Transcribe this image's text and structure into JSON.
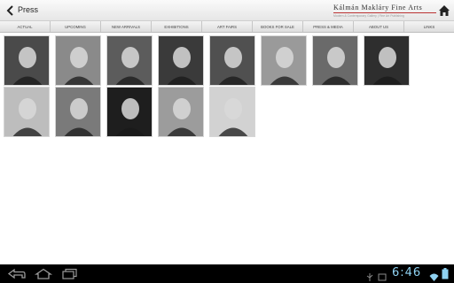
{
  "app": {
    "title": "Press",
    "back_icon": "back-chevron-icon",
    "home_icon": "home-icon",
    "brand": {
      "name": "Kálmán Makláry Fine Arts",
      "tagline": "Modern & Contemporary Gallery | Fine Art Publishing"
    }
  },
  "nav": {
    "items": [
      {
        "label": "ACTUAL"
      },
      {
        "label": "UPCOMING"
      },
      {
        "label": "NEW ARRIVALS"
      },
      {
        "label": "EXHIBITIONS"
      },
      {
        "label": "ART FAIRS"
      },
      {
        "label": "BOOKS FOR SALE"
      },
      {
        "label": "PRESS & MEDIA"
      },
      {
        "label": "ABOUT US"
      },
      {
        "label": "LINKS"
      }
    ]
  },
  "gallery": {
    "photos": [
      {
        "subject": "portrait-photo",
        "tone": "#4a4a4a"
      },
      {
        "subject": "portrait-photo",
        "tone": "#8a8a8a"
      },
      {
        "subject": "portrait-photo",
        "tone": "#5c5c5c"
      },
      {
        "subject": "portrait-photo",
        "tone": "#3a3a3a"
      },
      {
        "subject": "portrait-photo",
        "tone": "#505050"
      },
      {
        "subject": "portrait-photo",
        "tone": "#9a9a9a"
      },
      {
        "subject": "portrait-photo",
        "tone": "#6a6a6a"
      },
      {
        "subject": "portrait-photo",
        "tone": "#2e2e2e"
      },
      {
        "subject": "portrait-photo",
        "tone": "#bdbdbd"
      },
      {
        "subject": "portrait-photo",
        "tone": "#7a7a7a"
      },
      {
        "subject": "portrait-photo",
        "tone": "#1e1e1e"
      },
      {
        "subject": "portrait-photo",
        "tone": "#9c9c9c"
      },
      {
        "subject": "portrait-photo",
        "tone": "#d2d2d2"
      }
    ]
  },
  "system_bar": {
    "clock": "6:46",
    "icons": [
      "back-nav-icon",
      "home-nav-icon",
      "recent-apps-icon",
      "usb-icon",
      "screenshot-icon",
      "wifi-icon",
      "battery-icon"
    ]
  },
  "colors": {
    "accent_rule": "#b33333",
    "clock": "#8fd2f2",
    "system_bar": "#000000"
  }
}
